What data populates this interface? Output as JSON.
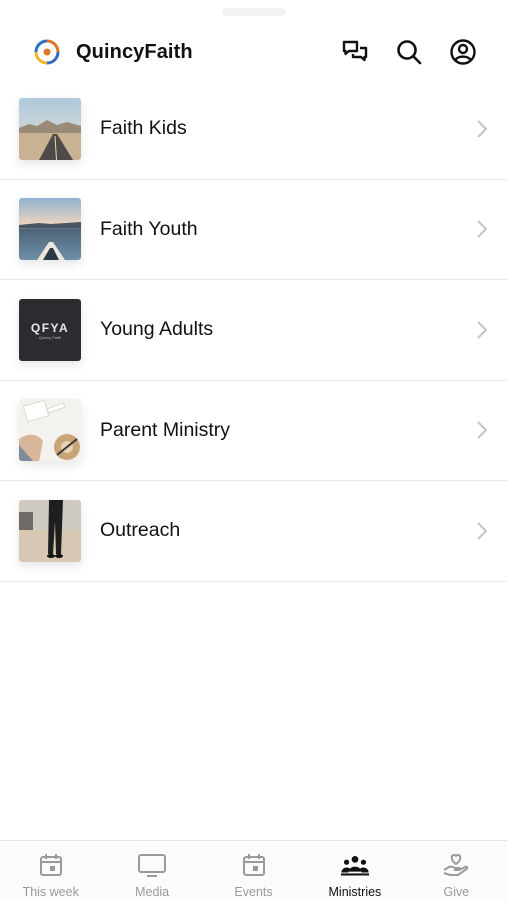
{
  "header": {
    "title": "QuincyFaith",
    "actions": [
      {
        "name": "messages",
        "icon": "chat-bubbles-icon"
      },
      {
        "name": "search",
        "icon": "search-icon"
      },
      {
        "name": "profile",
        "icon": "account-circle-icon"
      }
    ]
  },
  "ministries": [
    {
      "label": "Faith Kids",
      "thumbnail": "desert-road"
    },
    {
      "label": "Faith Youth",
      "thumbnail": "kayak-lake"
    },
    {
      "label": "Young Adults",
      "thumbnail": "qfya-logo",
      "thumb_text": "QFYA",
      "thumb_subtext": "Quincy Faith"
    },
    {
      "label": "Parent Ministry",
      "thumbnail": "hands-hat-notebook"
    },
    {
      "label": "Outreach",
      "thumbnail": "person-walking"
    }
  ],
  "tabs": [
    {
      "label": "This week",
      "icon": "calendar-icon",
      "active": false
    },
    {
      "label": "Media",
      "icon": "monitor-icon",
      "active": false
    },
    {
      "label": "Events",
      "icon": "calendar-icon",
      "active": false
    },
    {
      "label": "Ministries",
      "icon": "group-icon",
      "active": true
    },
    {
      "label": "Give",
      "icon": "hand-heart-icon",
      "active": false
    }
  ],
  "colors": {
    "text": "#111111",
    "inactive_tab": "#9a9a9a",
    "divider": "#ececec",
    "chevron": "#c4c4c4"
  }
}
